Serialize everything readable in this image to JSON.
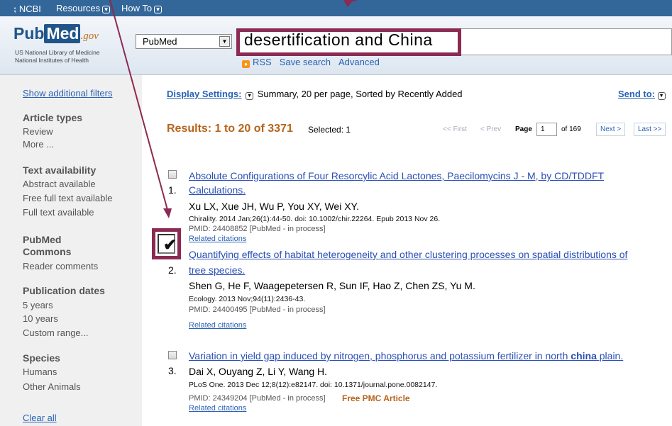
{
  "topbar": {
    "ncbi_label": "NCBI",
    "resources_label": "Resources",
    "howto_label": "How To"
  },
  "header": {
    "logo_pub": "Pub",
    "logo_med": "Med",
    "logo_gov": ".gov",
    "nlm_line1": "US National Library of Medicine",
    "nlm_line2": "National Institutes of Health",
    "database": "PubMed",
    "search_value": "desertification and China",
    "rss_label": "RSS",
    "save_search_label": "Save search",
    "advanced_label": "Advanced"
  },
  "sidebar": {
    "show_filters": "Show additional filters",
    "article_types": {
      "title": "Article types",
      "items": [
        "Review",
        "More ..."
      ]
    },
    "text_availability": {
      "title": "Text availability",
      "items": [
        "Abstract available",
        "Free full text available",
        "Full text available"
      ]
    },
    "pubmed_commons": {
      "title1": "PubMed",
      "title2": "Commons",
      "items": [
        "Reader comments"
      ]
    },
    "publication_dates": {
      "title": "Publication dates",
      "items": [
        "5 years",
        "10 years",
        "Custom range..."
      ]
    },
    "species": {
      "title": "Species",
      "items": [
        "Humans",
        "Other Animals"
      ]
    },
    "clear_all": "Clear all"
  },
  "display": {
    "settings_label": "Display Settings:",
    "settings_value": "Summary, 20 per page, Sorted by Recently Added",
    "send_to_label": "Send to:"
  },
  "results": {
    "summary": "Results: 1 to 20 of 3371",
    "selected": "Selected: 1",
    "pager": {
      "first": "<< First",
      "prev": "< Prev",
      "page_label": "Page",
      "page_value": "1",
      "of_pages": "of 169",
      "next": "Next >",
      "last": "Last >>"
    },
    "items": [
      {
        "number": "1.",
        "title_line1": "Absolute Configurations of Four Resorcylic Acid Lactones, Paecilomycins J - M, by CD/TDDFT",
        "title_line2": "Calculations.",
        "authors": "Xu LX, Xue JH, Wu P, You XY, Wei XY.",
        "citation": "Chirality. 2014 Jan;26(1):44-50. doi: 10.1002/chir.22264. Epub 2013 Nov 26.",
        "pmid": "PMID: 24408852 [PubMed - in process]",
        "related": "Related citations",
        "checked": false
      },
      {
        "number": "2.",
        "title_line1": "Quantifying effects of habitat heterogeneity and other clustering processes on spatial distributions of",
        "title_line2": "tree species.",
        "authors": "Shen G, He F, Waagepetersen R, Sun IF, Hao Z, Chen ZS, Yu M.",
        "citation": "Ecology. 2013 Nov;94(11):2436-43.",
        "pmid": "PMID: 24400495 [PubMed - in process]",
        "related": "Related citations",
        "checked": true
      },
      {
        "number": "3.",
        "title_pre": "Variation in yield gap induced by nitrogen, phosphorus and potassium fertilizer in north ",
        "title_bold": "china",
        "title_post": " plain.",
        "authors": "Dai X, Ouyang Z, Li Y, Wang H.",
        "citation": "PLoS One. 2013 Dec 12;8(12):e82147. doi: 10.1371/journal.pone.0082147.",
        "pmid": "PMID: 24349204 [PubMed - in process]",
        "free_pmc": "Free PMC Article",
        "related": "Related citations",
        "checked": false
      }
    ]
  },
  "colors": {
    "topbar": "#336699",
    "highlight": "#8b2a52",
    "link": "#2a4fb5",
    "results_heading": "#b5651d",
    "free_pmc": "#b5651d"
  }
}
